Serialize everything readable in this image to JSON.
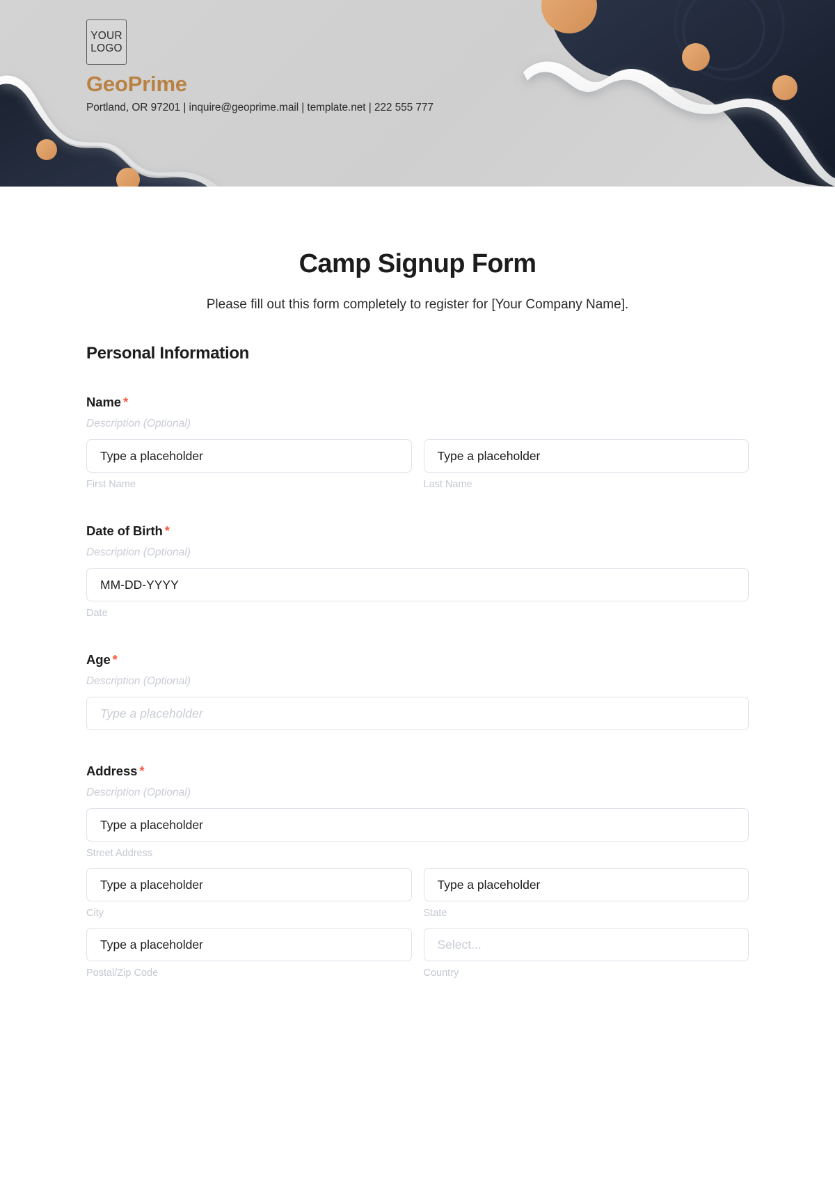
{
  "header": {
    "logo_line1": "YOUR",
    "logo_line2": "LOGO",
    "brand_name": "GeoPrime",
    "contact_line": "Portland, OR 97201 | inquire@geoprime.mail | template.net | 222 555 777",
    "colors": {
      "background": "#cfcfcf",
      "brand": "#b98244",
      "dark_shape": "#232b3d",
      "accent_dot": "#e5a269",
      "wave": "#f0f1f2"
    }
  },
  "form": {
    "title": "Camp Signup Form",
    "subtitle": "Please fill out this form completely to register for [Your Company Name].",
    "section_heading": "Personal Information",
    "required_marker": "*",
    "description_placeholder": "Description (Optional)",
    "fields": [
      {
        "label": "Name",
        "required": true,
        "description": "Description (Optional)",
        "inputs": [
          {
            "value": "Type a placeholder",
            "sub_label": "First Name",
            "style": "filled"
          },
          {
            "value": "Type a placeholder",
            "sub_label": "Last Name",
            "style": "filled"
          }
        ]
      },
      {
        "label": "Date of Birth",
        "required": true,
        "description": "Description (Optional)",
        "inputs": [
          {
            "value": "MM-DD-YYYY",
            "sub_label": "Date",
            "style": "filled"
          }
        ]
      },
      {
        "label": "Age",
        "required": true,
        "description": "Description (Optional)",
        "inputs": [
          {
            "value": "Type a placeholder",
            "sub_label": "",
            "style": "muted"
          }
        ]
      },
      {
        "label": "Address",
        "required": true,
        "description": "Description (Optional)",
        "inputs": [
          {
            "value": "Type a placeholder",
            "sub_label": "Street Address",
            "style": "filled"
          },
          {
            "value": "Type a placeholder",
            "sub_label": "City",
            "style": "filled"
          },
          {
            "value": "Type a placeholder",
            "sub_label": "State",
            "style": "filled"
          },
          {
            "value": "Type a placeholder",
            "sub_label": "Postal/Zip Code",
            "style": "filled"
          },
          {
            "value": "Select...",
            "sub_label": "Country",
            "style": "select"
          }
        ]
      }
    ]
  }
}
